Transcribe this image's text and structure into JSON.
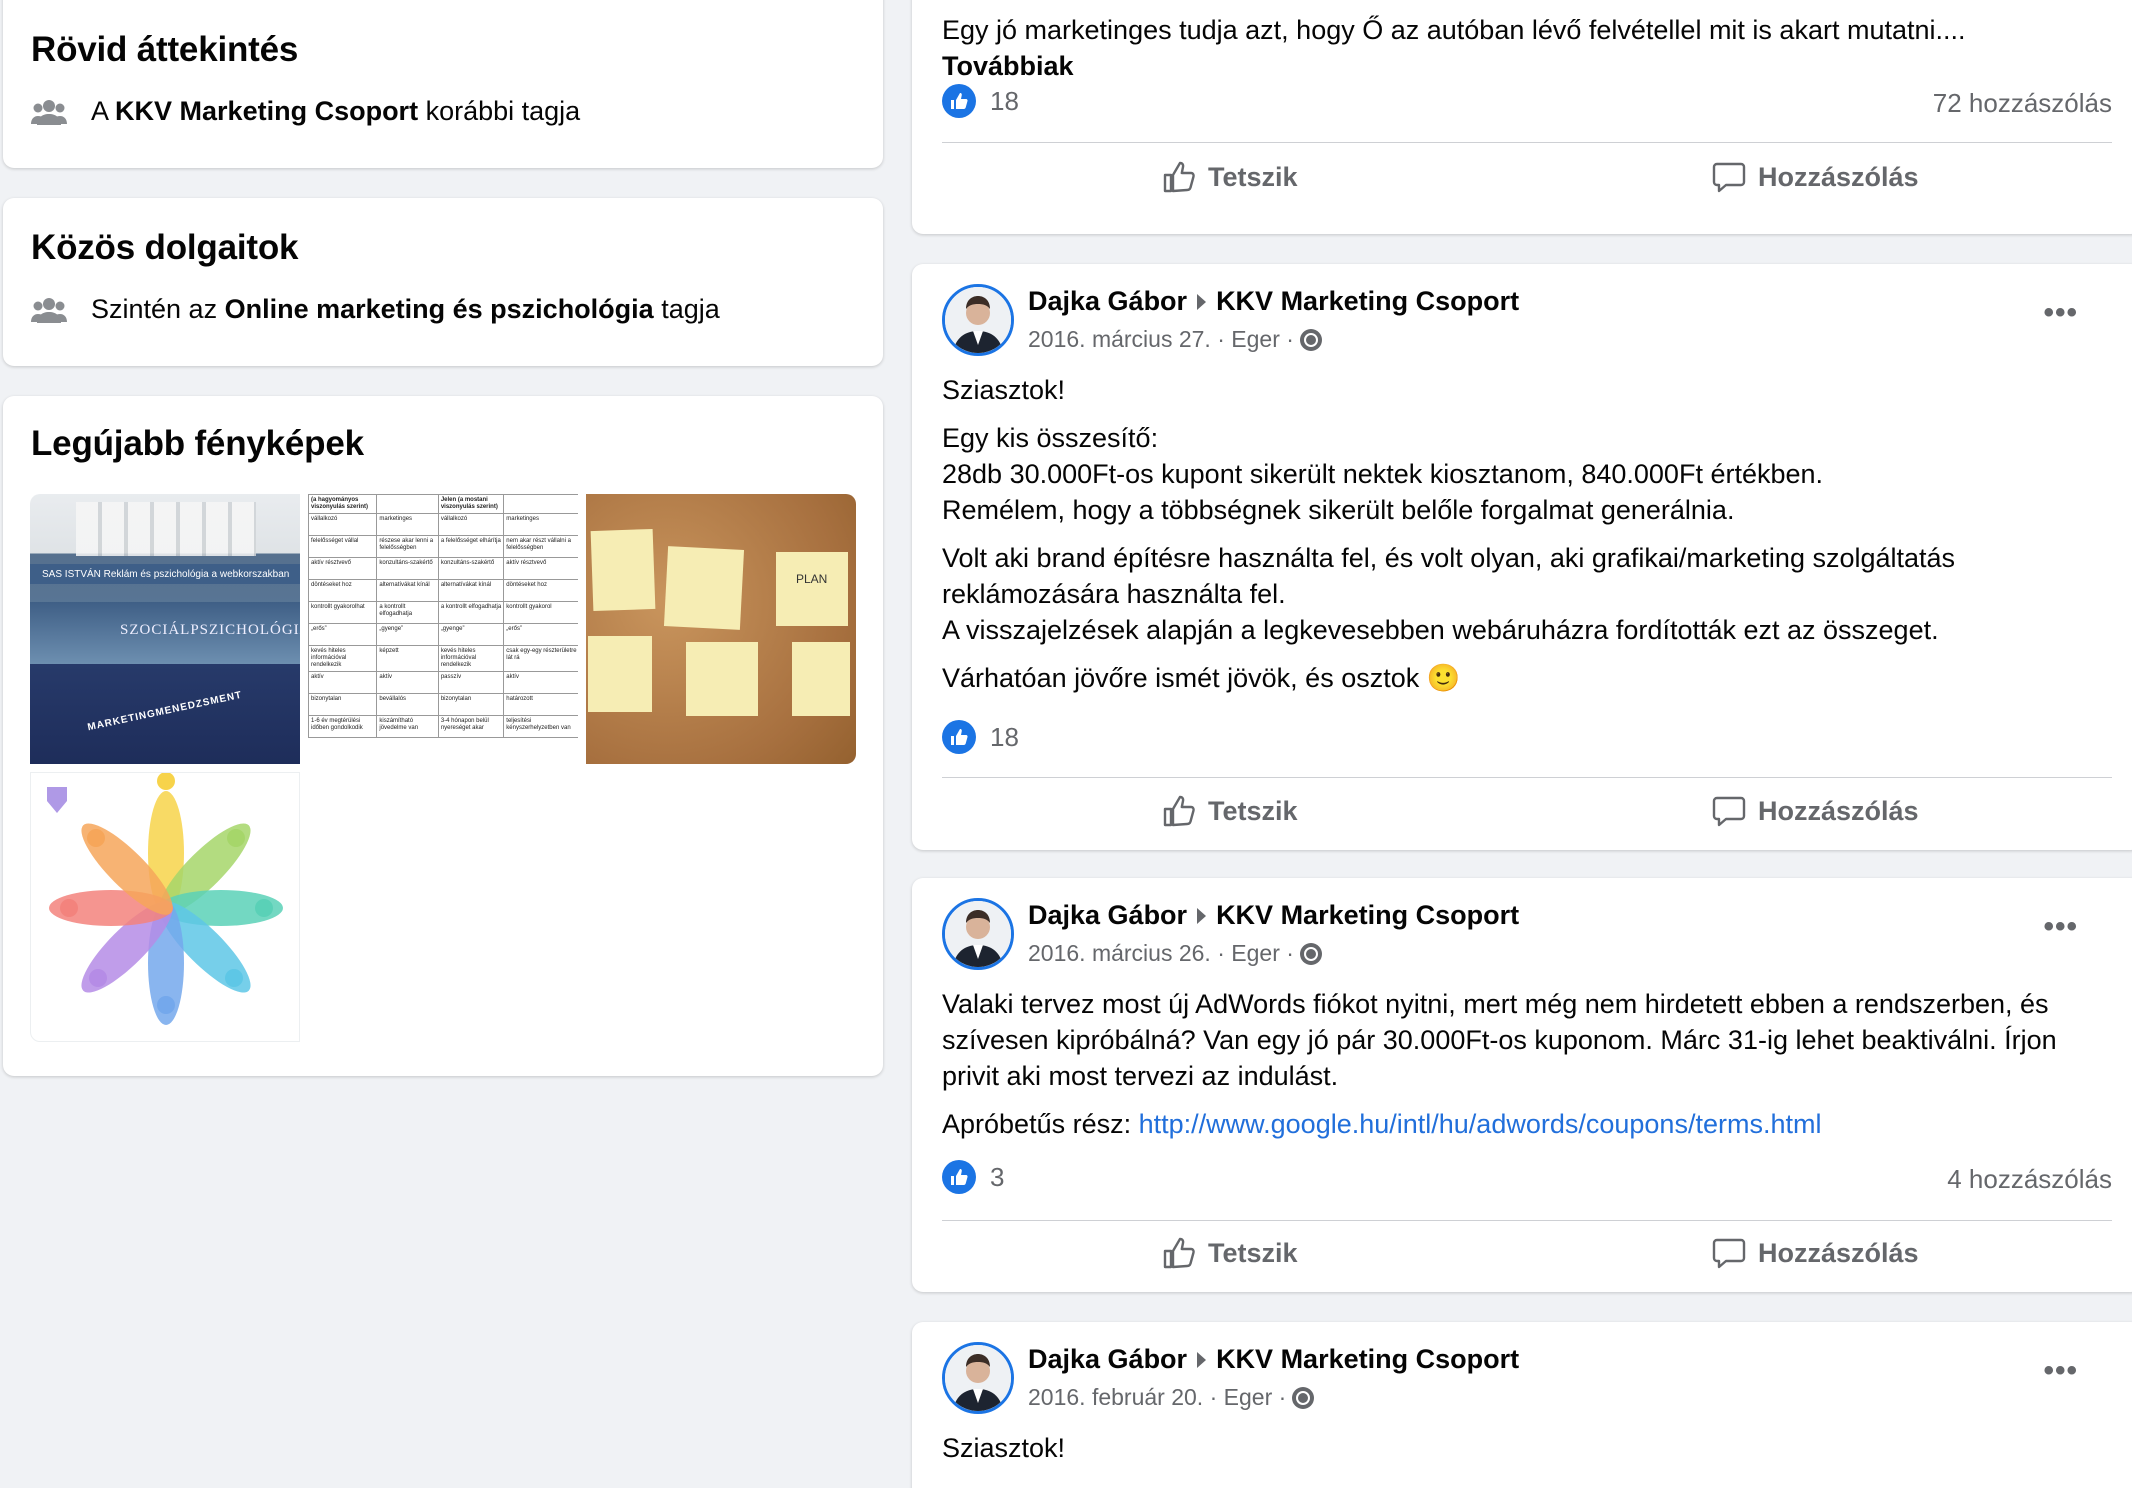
{
  "summary": {
    "title": "Rövid áttekintés",
    "pre": "A ",
    "group": "KKV Marketing Csoport",
    "post": " korábbi tagja"
  },
  "common": {
    "title": "Közös dolgaitok",
    "pre": "Szintén az ",
    "group": "Online marketing és pszichológia",
    "post": " tagja"
  },
  "photos": {
    "title": "Legújabb fényképek"
  },
  "book_spines": [
    "SAS ISTVÁN  Reklám és pszichológia a webkorszakban",
    "SZOCIÁLPSZICHOLÓGIA",
    "MARKETINGMENEDZSMENT"
  ],
  "table_photo": {
    "headers": [
      "(a hagyományos viszonyulás szerint)",
      "",
      "Jelen (a mostani viszonyulás szerint)",
      ""
    ],
    "rows": [
      [
        "vállalkozó",
        "marketinges",
        "vállalkozó",
        "marketinges"
      ],
      [
        "felelősséget vállal",
        "részese akar lenni a felelősségben",
        "a felelősséget elhárítja",
        "nem akar részt vállalni a felelősségben"
      ],
      [
        "aktív résztvevő",
        "konzultáns-szakértő",
        "konzultáns-szakértő",
        "aktív résztvevő"
      ],
      [
        "döntéseket hoz",
        "alternatívákat kínál",
        "alternatívákat kínál",
        "döntéseket hoz"
      ],
      [
        "kontrollt gyakorolhat",
        "a kontrollt elfogadhatja",
        "a kontrollt elfogadhatja",
        "kontrollt gyakorol"
      ],
      [
        "„erős”",
        "„gyenge”",
        "„gyenge”",
        "„erős”"
      ],
      [
        "kevés hiteles információval rendelkezik",
        "képzett",
        "kevés hiteles információval rendelkezik",
        "csak egy-egy részterületre lát rá"
      ],
      [
        "aktív",
        "aktív",
        "passzív",
        "aktív"
      ],
      [
        "bizonytalan",
        "bevállalós",
        "bizonytalan",
        "határozott"
      ],
      [
        "1-6 év megtérülési időben gondolkodik",
        "kiszámítható jövedelme van",
        "3-4 hónapon belül nyereséget akar",
        "teljesítési kényszerhelyzetben van"
      ]
    ]
  },
  "cork_notes": [
    "PLAN"
  ],
  "top_post": {
    "text": "Egy jó marketinges tudja azt, hogy Ő az autóban lévő felvétellel mit is akart mutatni....",
    "more": "Továbbiak",
    "likes": "18",
    "comments": "72 hozzászólás"
  },
  "actions": {
    "like": "Tetszik",
    "comment": "Hozzászólás"
  },
  "posts": [
    {
      "author": "Dajka Gábor",
      "group": "KKV Marketing Csoport",
      "date": "2016. március 27.",
      "location": "Eger",
      "p1": "Sziasztok!",
      "p2a": "Egy kis összesítő:",
      "p2b": "28db 30.000Ft-os kupont sikerült nektek kiosztanom, 840.000Ft értékben.",
      "p2c": "Remélem, hogy a többségnek sikerült belőle forgalmat generálnia.",
      "p3a": "Volt aki brand építésre használta fel, és volt olyan, aki grafikai/marketing szolgáltatás",
      "p3b": "reklámozására használta fel.",
      "p3c": "A visszajelzések alapján a legkevesebben webáruházra fordították ezt az összeget.",
      "p4": "Várhatóan jövőre ismét jövök, és osztok 🙂",
      "likes": "18"
    },
    {
      "author": "Dajka Gábor",
      "group": "KKV Marketing Csoport",
      "date": "2016. március 26.",
      "location": "Eger",
      "p1a": "Valaki tervez most új AdWords fiókot nyitni, mert még nem hirdetett ebben a rendszerben, és",
      "p1b": "szívesen kipróbálná? Van egy jó pár 30.000Ft-os kuponom. Márc 31-ig lehet beaktiválni. Írjon",
      "p1c": "privit aki most tervezi az indulást.",
      "p2": "Apróbetűs rész: ",
      "link": "http://www.google.hu/intl/hu/adwords/coupons/terms.html",
      "likes": "3",
      "comments": "4 hozzászólás"
    },
    {
      "author": "Dajka Gábor",
      "group": "KKV Marketing Csoport",
      "date": "2016. február 20.",
      "location": "Eger",
      "p1": "Sziasztok!"
    }
  ],
  "colors": {
    "accent": "#1b74e4",
    "link": "#216fdb",
    "secondary_text": "#65676b",
    "bg": "#f0f2f5"
  }
}
